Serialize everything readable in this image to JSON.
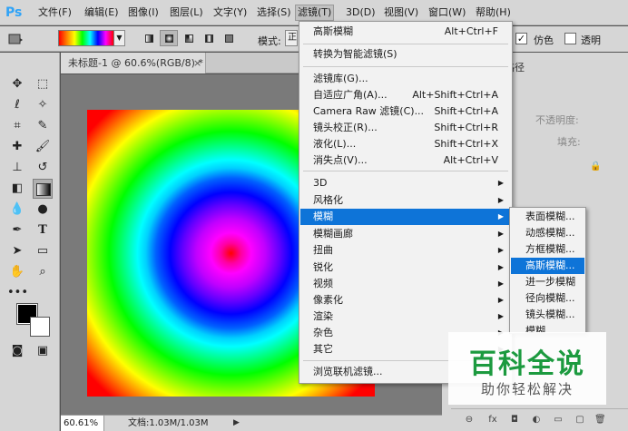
{
  "app": {
    "logo": "Ps"
  },
  "menubar": {
    "items": [
      "文件(F)",
      "编辑(E)",
      "图像(I)",
      "图层(L)",
      "文字(Y)",
      "选择(S)",
      "滤镜(T)",
      "3D(D)",
      "视图(V)",
      "窗口(W)",
      "帮助(H)"
    ],
    "active_index": 6
  },
  "options": {
    "mode_label": "模式:",
    "mode_value": "正",
    "simulate_label": "仿色",
    "transparency_label": "透明"
  },
  "document": {
    "tab_title": "未标题-1 @ 60.6%(RGB/8) *",
    "close_glyph": "×",
    "zoom": "60.61%",
    "doc_info": "文档:1.03M/1.03M",
    "status_arrow": "▶"
  },
  "panels": {
    "tab": "路径",
    "opacity_label": "不透明度:",
    "fill_label": "填充:"
  },
  "filter_menu": {
    "items": [
      {
        "label": "高斯模糊",
        "shortcut": "Alt+Ctrl+F"
      },
      {
        "label": "转换为智能滤镜(S)",
        "shortcut": ""
      },
      {
        "label": "滤镜库(G)...",
        "shortcut": ""
      },
      {
        "label": "自适应广角(A)...",
        "shortcut": "Alt+Shift+Ctrl+A"
      },
      {
        "label": "Camera Raw 滤镜(C)...",
        "shortcut": "Shift+Ctrl+A"
      },
      {
        "label": "镜头校正(R)...",
        "shortcut": "Shift+Ctrl+R"
      },
      {
        "label": "液化(L)...",
        "shortcut": "Shift+Ctrl+X"
      },
      {
        "label": "消失点(V)...",
        "shortcut": "Alt+Ctrl+V"
      },
      {
        "label": "3D",
        "submenu": true
      },
      {
        "label": "风格化",
        "submenu": true
      },
      {
        "label": "模糊",
        "submenu": true,
        "highlighted": true
      },
      {
        "label": "模糊画廊",
        "submenu": true
      },
      {
        "label": "扭曲",
        "submenu": true
      },
      {
        "label": "锐化",
        "submenu": true
      },
      {
        "label": "视频",
        "submenu": true
      },
      {
        "label": "像素化",
        "submenu": true
      },
      {
        "label": "渲染",
        "submenu": true
      },
      {
        "label": "杂色",
        "submenu": true
      },
      {
        "label": "其它",
        "submenu": true
      },
      {
        "label": "浏览联机滤镜...",
        "shortcut": ""
      }
    ],
    "submenu_arrow": "▶"
  },
  "blur_submenu": {
    "items": [
      "表面模糊...",
      "动感模糊...",
      "方框模糊...",
      "高斯模糊...",
      "进一步模糊",
      "径向模糊...",
      "镜头模糊...",
      "模糊"
    ],
    "highlighted_index": 3
  },
  "watermark": {
    "title": "百科全说",
    "subtitle": "助你轻松解决"
  },
  "colors": {
    "highlight": "#0e74d8",
    "foreground": "#000000",
    "background": "#ffffff",
    "watermark_green": "#1c9a3f"
  }
}
